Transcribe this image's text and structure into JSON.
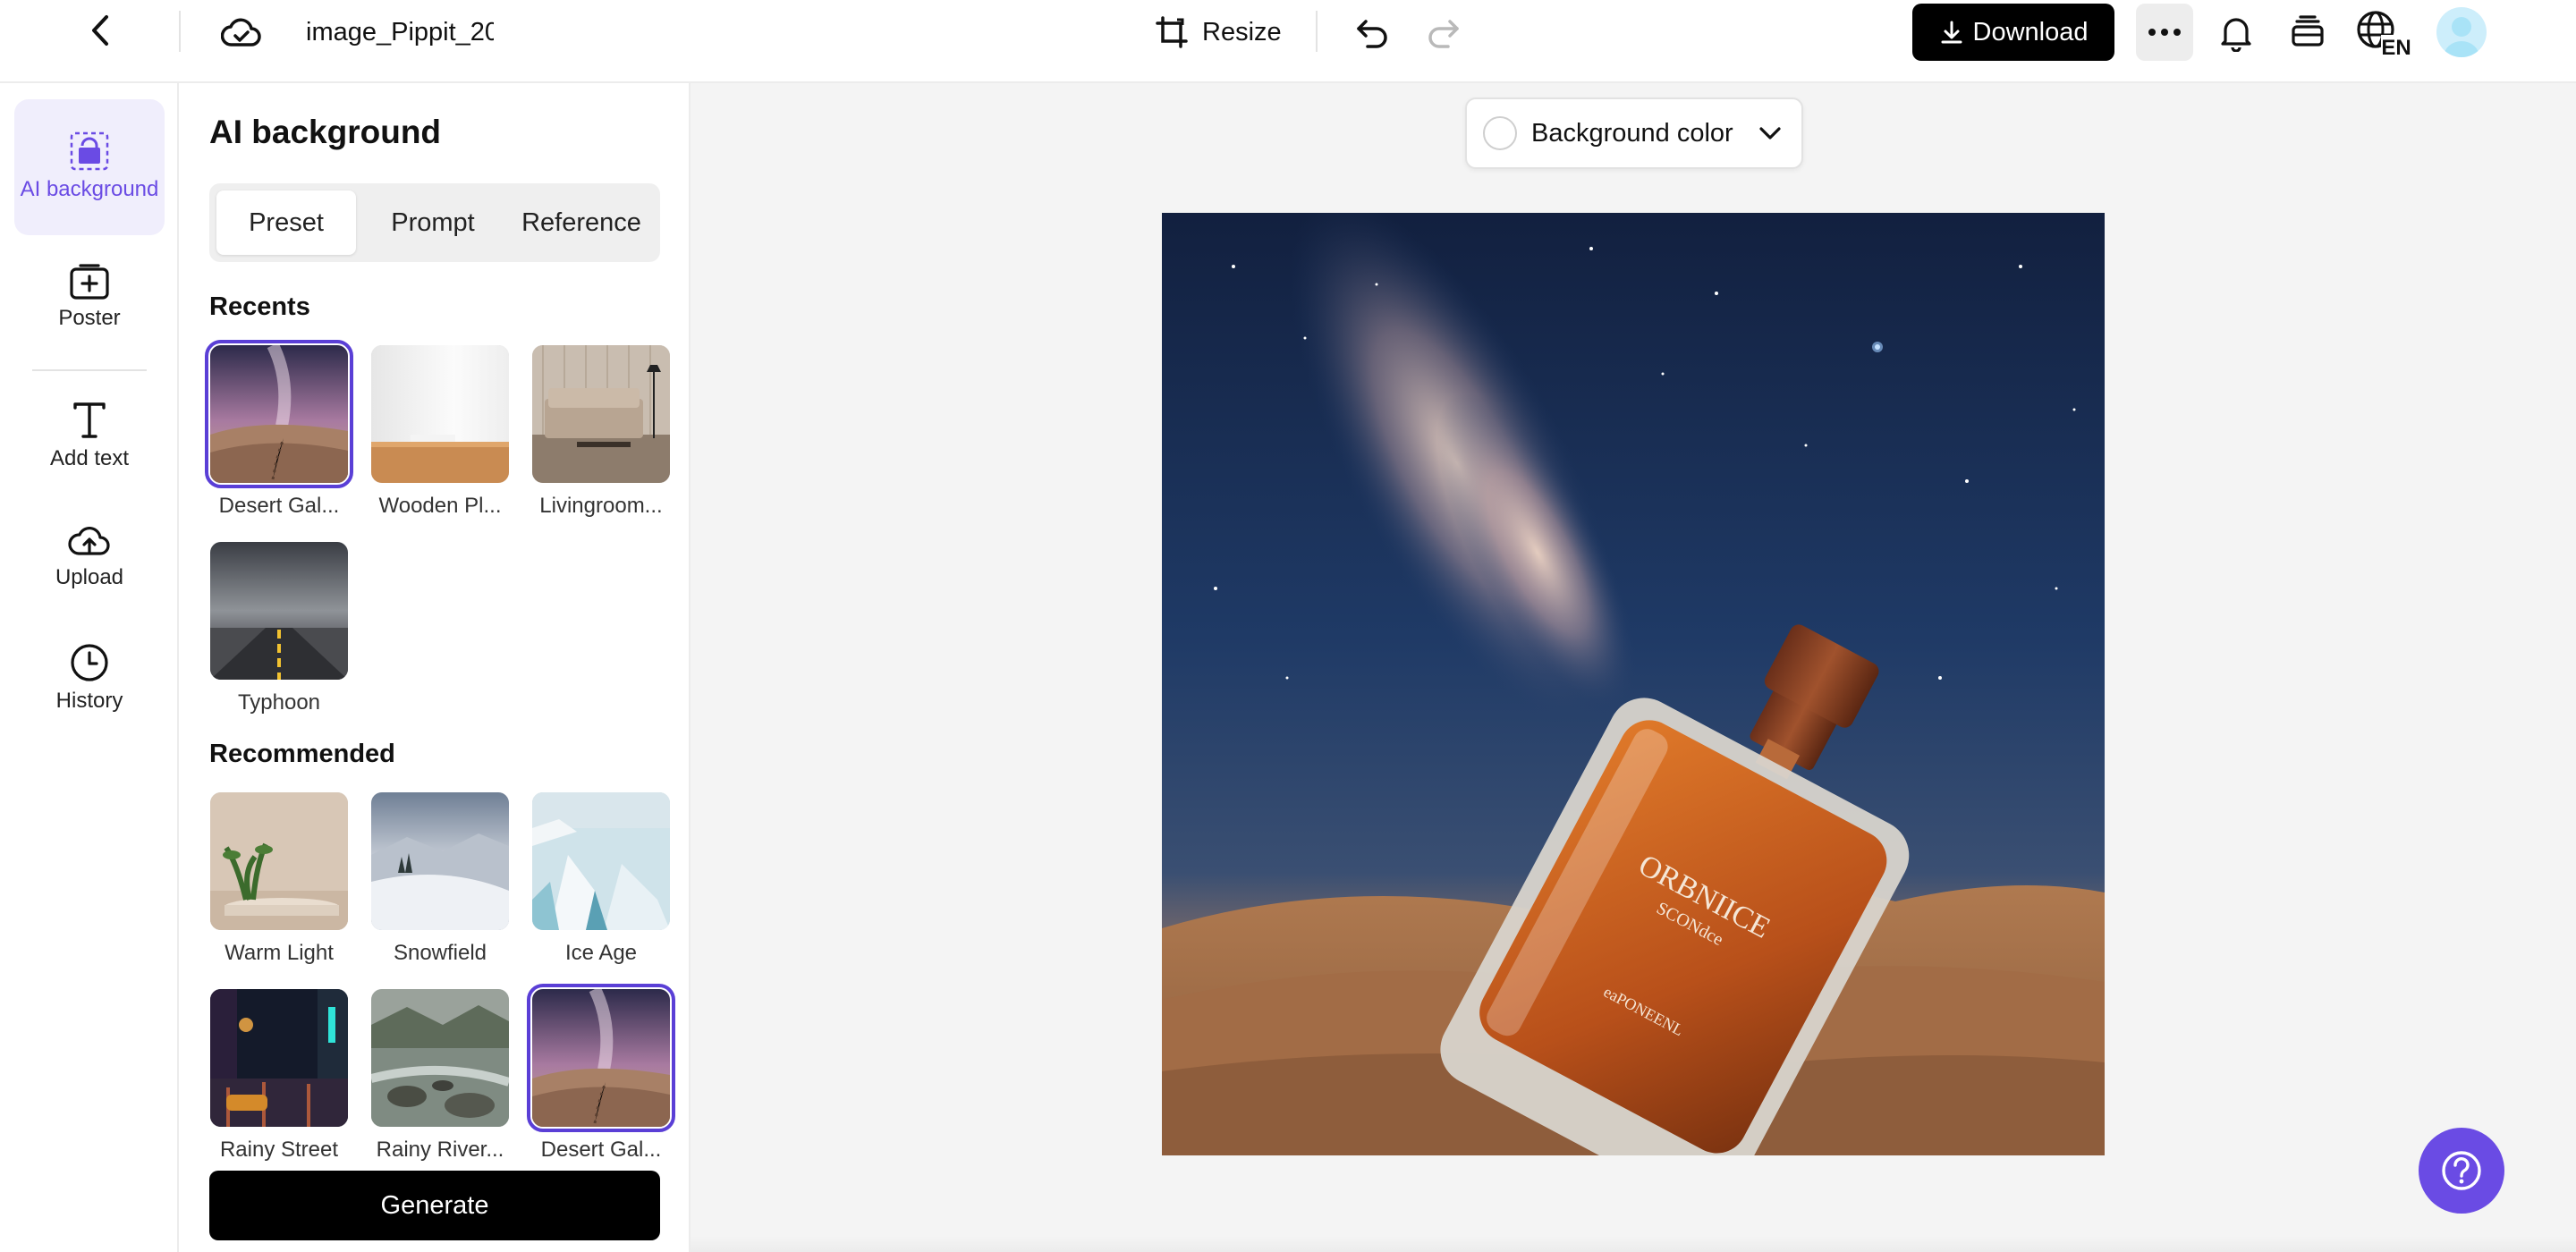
{
  "header": {
    "doc_title": "image_Pippit_20",
    "resize_label": "Resize",
    "download_label": "Download",
    "lang_code": "EN"
  },
  "rail": {
    "items": [
      {
        "label": "AI background",
        "icon": "ai-background-icon",
        "active": true
      },
      {
        "label": "Poster",
        "icon": "poster-icon"
      },
      {
        "label": "Add text",
        "icon": "text-icon"
      },
      {
        "label": "Upload",
        "icon": "upload-icon"
      },
      {
        "label": "History",
        "icon": "history-icon"
      }
    ]
  },
  "panel": {
    "title": "AI background",
    "tabs": [
      {
        "label": "Preset",
        "active": true
      },
      {
        "label": "Prompt"
      },
      {
        "label": "Reference"
      }
    ],
    "recents_heading": "Recents",
    "recents": [
      {
        "label": "Desert Gal...",
        "selected": true
      },
      {
        "label": "Wooden Pl..."
      },
      {
        "label": "Livingroom..."
      },
      {
        "label": "Typhoon"
      }
    ],
    "recommended_heading": "Recommended",
    "recommended": [
      {
        "label": "Warm Light"
      },
      {
        "label": "Snowfield"
      },
      {
        "label": "Ice Age"
      },
      {
        "label": "Rainy Street"
      },
      {
        "label": "Rainy River..."
      },
      {
        "label": "Desert Gal...",
        "selected": true
      }
    ],
    "generate_label": "Generate"
  },
  "canvas": {
    "bg_color_label": "Background color"
  },
  "colors": {
    "accent": "#6a4be4",
    "selection": "#5a3fd6",
    "primary_button": "#000000",
    "canvas_bg": "#f4f4f4"
  }
}
